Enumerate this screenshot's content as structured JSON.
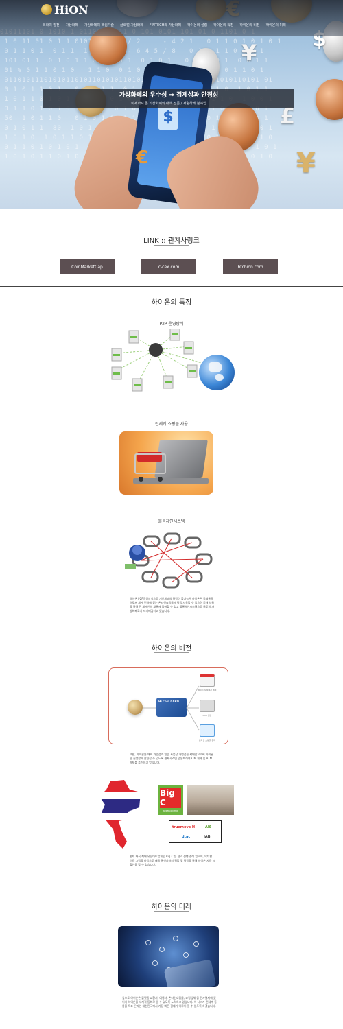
{
  "header": {
    "logo_text": "HiON",
    "nav": [
      "회화의 발전",
      "가상화폐",
      "가상화폐의 핵심기술",
      "글로벌 가상화폐",
      "FINTECH와 가상화폐",
      "하이온의 설립",
      "하이온의 특징",
      "하이온의 비전",
      "하이온의 미래"
    ]
  },
  "hero": {
    "title": "가상화폐의 우수성 ⇒ 경제성과 안정성",
    "subtitle": "이제까지 돈 가상화폐의 대책 전문 / 저렴하게 분야입"
  },
  "links": {
    "title": "LINK :: 관계사링크",
    "buttons": [
      "CoinMarketCap",
      "c-cex.com",
      "btchion.com"
    ]
  },
  "features": {
    "title": "하이온의 특징",
    "items": [
      {
        "caption": "P2P 운영방식"
      },
      {
        "caption": "전세계 쇼핑몰 사용"
      },
      {
        "caption": "블록체인시스템"
      }
    ],
    "paragraph": "하이온 P2P운영방식으로 개인계좌의 통장이 불가능한 하이온은 국제통용으로써 세계 전역에 있는 온라인쇼핑몰에 직접 사용할 수 있으며 공개 채굴을 통해 전 세계인의 채굴에 참여할 수 있고 블록체인시스템으로 글로벌 가상화폐로서 자리매김하고 있습니다."
  },
  "vision": {
    "title": "하이온의 비전",
    "card_label": "Hi Coin CARD",
    "icon_captions": [
      "하이온 상점에서 결제",
      "ATM 인출",
      "온라인 쇼핑몰 결제"
    ],
    "paragraph1": "또한, 하이온은 해외 가맹점과 일반 사업장 가맹점을 확대함으로써 하이온을 실생활에 활용할 수 있도록 결제시스템 연동화하여ATM 체제 및 ATM 체제를 추진하고 있습니다.",
    "bigc_text": "Big C",
    "bigc_sub": "SUPERCENTER",
    "brands": [
      "truemove H",
      "AIS",
      "dtac",
      "JAB"
    ],
    "paragraph2": "현재 태국 최대 유선마트업체인 Big C 등 협의 진행 중에 있으며, 막대한 이용 고객을 바탕으로 태국 통신사와의 결합 및 확장을 통해 하이온 사용 시 할인을 할 수 있습니다."
  },
  "future": {
    "title": "하이온의 미래",
    "paragraph": "앞으로 하이온은 플랫폼 교환처, 여행사, 온라인쇼핑몰, 쇼핑업체 등 전자결제에 있어서 하이온을 세계적 통화로 쓸 수 있도록 노력하고 있습니다. 이 나라가 전세계 통용을 목표 온라인 대한민국에서 가장 빠른 결제가 이루어 질 수 있도록 하겠습니다."
  }
}
